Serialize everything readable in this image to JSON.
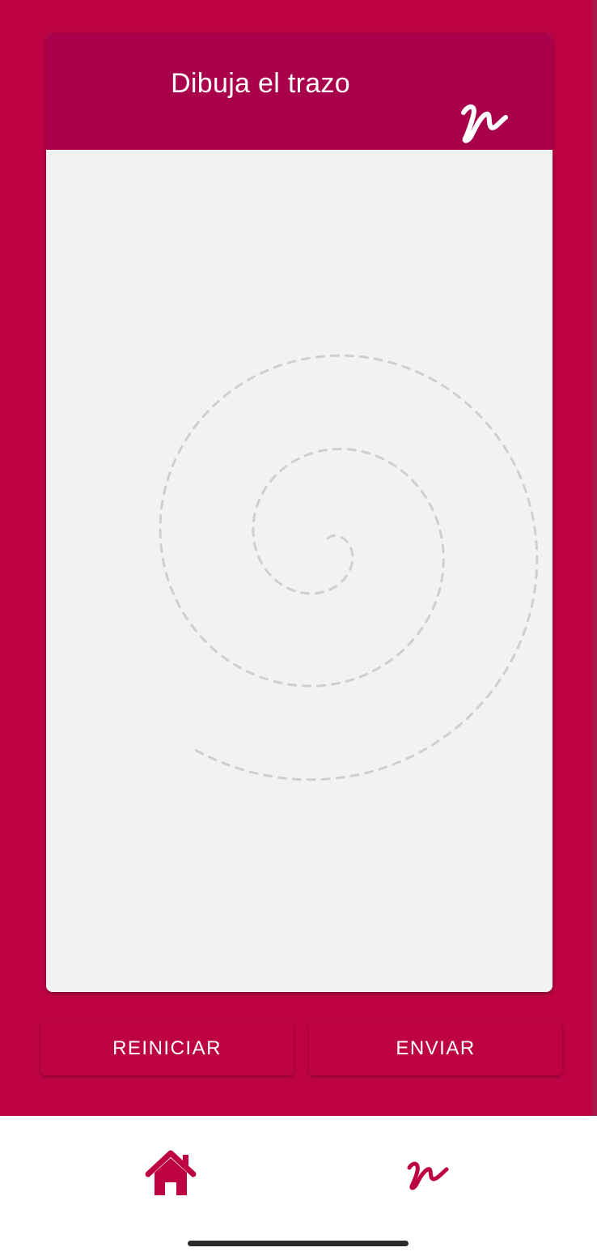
{
  "colors": {
    "primary": "#be0345",
    "header": "#a8004a",
    "canvas": "#f2f2f2",
    "guide_stroke": "#cfcfcf"
  },
  "card": {
    "title": "Dibuja el trazo",
    "header_icon": "cursive-stroke-icon",
    "canvas_guide": "dashed-spiral-guide"
  },
  "actions": {
    "reset_label": "REINICIAR",
    "send_label": "ENVIAR"
  },
  "bottom_nav": {
    "items": [
      {
        "icon": "home-icon"
      },
      {
        "icon": "cursive-stroke-icon"
      }
    ]
  }
}
